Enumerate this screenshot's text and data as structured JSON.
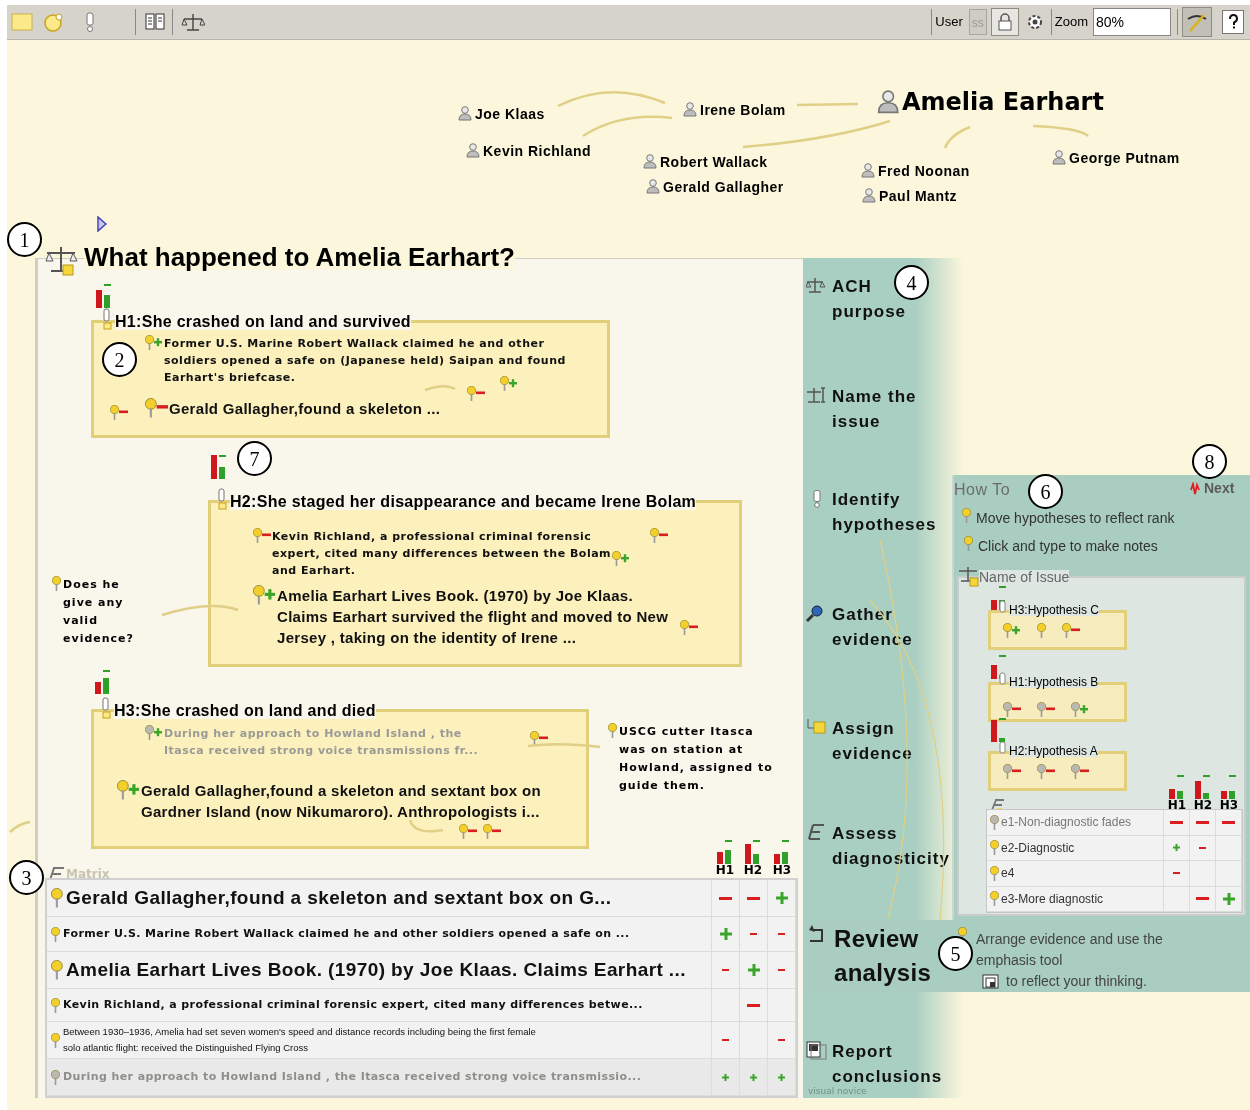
{
  "toolbar": {
    "user_label": "User",
    "user_value": "ss",
    "zoom_label": "Zoom",
    "zoom_value": "80%"
  },
  "people": [
    {
      "name": "Joe Klaas",
      "kind": "person"
    },
    {
      "name": "Kevin Richland",
      "kind": "person"
    },
    {
      "name": "Irene Bolam",
      "kind": "person"
    },
    {
      "name": "Amelia Earhart",
      "kind": "subject"
    },
    {
      "name": "Robert Wallack",
      "kind": "person"
    },
    {
      "name": "Gerald Gallagher",
      "kind": "person"
    },
    {
      "name": "Fred Noonan",
      "kind": "person"
    },
    {
      "name": "Paul Mantz",
      "kind": "person"
    },
    {
      "name": "George Putnam",
      "kind": "person"
    }
  ],
  "issue": {
    "title": "What happened to Amelia Earhart?"
  },
  "hypotheses": [
    {
      "label": "H1:",
      "title": "She crashed on land and survived",
      "evidence": [
        {
          "text": "Former U.S. Marine Robert Wallack claimed he and other soldiers opened a safe on (Japanese held) Saipan and found Earhart's briefcase.",
          "kind": "note",
          "positive": true,
          "faded": false
        },
        {
          "text": "Gerald Gallagher,found a skeleton ...",
          "kind": "headline",
          "positive": false,
          "faded": false
        }
      ]
    },
    {
      "label": "H2:",
      "title": "She staged her disappearance and became Irene Bolam",
      "evidence": [
        {
          "text": "Kevin Richland, a professional criminal forensic expert, cited many differences between the Bolam and Earhart.",
          "kind": "note",
          "positive": false,
          "faded": false
        },
        {
          "text": "Amelia Earhart Lives Book. (1970) by Joe Klaas. Claims Earhart survived the flight and moved to New Jersey , taking on the identity of Irene ...",
          "kind": "headline",
          "positive": true,
          "faded": false
        }
      ]
    },
    {
      "label": "H3:",
      "title": "She crashed on land and died",
      "evidence": [
        {
          "text": "During her approach to Howland Island , the Itasca received strong voice transmissions fr...",
          "kind": "note",
          "positive": true,
          "faded": true
        },
        {
          "text": "Gerald Gallagher,found a skeleton and sextant box on Gardner Island (now Nikumaroro). Anthropologists i...",
          "kind": "headline",
          "positive": true,
          "faded": false
        }
      ]
    }
  ],
  "notes": [
    {
      "text": "Does he give any valid evidence?"
    },
    {
      "text": "USCG cutter Itasca was on station at Howland, assigned to guide them."
    }
  ],
  "matrix": {
    "title": "Matrix",
    "columns": [
      "H1",
      "H2",
      "H3"
    ],
    "rows": [
      {
        "text": "Gerald Gallagher,found a skeleton and sextant box on G...",
        "kind": "headline",
        "faded": false,
        "cells": [
          {
            "positive": false,
            "strong": true
          },
          {
            "positive": false,
            "strong": true
          },
          {
            "positive": true,
            "strong": true
          }
        ]
      },
      {
        "text": "Former U.S. Marine Robert Wallack claimed he and other soldiers opened a safe on ...",
        "kind": "note",
        "faded": false,
        "cells": [
          {
            "positive": true,
            "strong": true
          },
          {
            "positive": false,
            "strong": false
          },
          {
            "positive": false,
            "strong": false
          }
        ]
      },
      {
        "text": "Amelia Earhart Lives Book. (1970) by Joe Klaas. Claims Earhart ...",
        "kind": "headline",
        "faded": false,
        "cells": [
          {
            "positive": false,
            "strong": false
          },
          {
            "positive": true,
            "strong": true
          },
          {
            "positive": false,
            "strong": false
          }
        ]
      },
      {
        "text": "Kevin Richland, a professional criminal forensic expert, cited many differences betwe...",
        "kind": "note",
        "faded": false,
        "cells": [
          null,
          {
            "positive": false,
            "strong": true
          },
          null
        ]
      },
      {
        "text": "Between 1930–1936, Amelia had set seven women's speed and distance records including being the first female solo atlantic flight: received the Distinguished Flying Cross",
        "kind": "fine",
        "faded": false,
        "cells": [
          {
            "positive": false,
            "strong": false
          },
          null,
          {
            "positive": false,
            "strong": false
          }
        ]
      },
      {
        "text": "During her approach to Howland Island , the Itasca received strong voice transmissio...",
        "kind": "note",
        "faded": true,
        "cells": [
          {
            "positive": true,
            "strong": false
          },
          {
            "positive": true,
            "strong": false
          },
          {
            "positive": true,
            "strong": false
          }
        ]
      }
    ]
  },
  "steps": [
    {
      "label": "ACH purpose",
      "selected": false
    },
    {
      "label": "Name the issue",
      "selected": false
    },
    {
      "label": "Identify hypotheses",
      "selected": false
    },
    {
      "label": "Gather evidence",
      "selected": false
    },
    {
      "label": "Assign evidence",
      "selected": false
    },
    {
      "label": "Assess diagnosticity",
      "selected": false
    },
    {
      "label": "Review analysis",
      "selected": true
    },
    {
      "label": "Report conclusions",
      "selected": false
    }
  ],
  "how_to": {
    "title": "How To",
    "next": "Next",
    "tips": [
      "Move hypotheses to reflect rank",
      "Click and type to make notes"
    ],
    "example": {
      "issue": "Name of Issue",
      "hypotheses": [
        {
          "label": "H3:",
          "title": "Hypothesis C"
        },
        {
          "label": "H1:",
          "title": "Hypothesis B"
        },
        {
          "label": "H2:",
          "title": "Hypothesis A"
        }
      ],
      "columns": [
        "H1",
        "H2",
        "H3"
      ],
      "rows": [
        {
          "text": "e1-Non-diagnostic fades",
          "faded": true,
          "cells": [
            {
              "positive": false,
              "strong": true
            },
            {
              "positive": false,
              "strong": true
            },
            {
              "positive": false,
              "strong": true
            }
          ]
        },
        {
          "text": "e2-Diagnostic",
          "faded": false,
          "cells": [
            {
              "positive": true,
              "strong": false
            },
            {
              "positive": false,
              "strong": false
            },
            null
          ]
        },
        {
          "text": "e4",
          "faded": false,
          "cells": [
            {
              "positive": false,
              "strong": false
            },
            null,
            null
          ]
        },
        {
          "text": "e3-More diagnostic",
          "faded": false,
          "cells": [
            null,
            {
              "positive": false,
              "strong": true
            },
            {
              "positive": true,
              "strong": true
            }
          ]
        }
      ]
    }
  },
  "review_tip": {
    "before": "Arrange evidence and use the emphasis tool",
    "after": "to reflect your thinking."
  },
  "footer": "visual novice",
  "callouts": [
    "1",
    "2",
    "3",
    "4",
    "5",
    "6",
    "7",
    "8"
  ]
}
